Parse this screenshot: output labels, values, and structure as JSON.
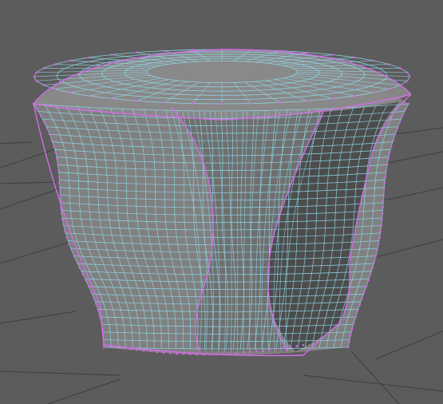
{
  "viewport": {
    "background": "#5c5c5c",
    "grid_color": "#3e3e3e",
    "object": {
      "semantic": "quad-mesh-wireframe",
      "body_color": "#808080",
      "front_color": "#7e7e7e",
      "shadow_color": "#4c4c4c",
      "inner_color": "#6f6f6f",
      "top_color": "#8a8a8a",
      "wire_color": "#8fd8e8",
      "edge_color": "#d26ee6",
      "vertex_color": "#e05cf0"
    }
  }
}
